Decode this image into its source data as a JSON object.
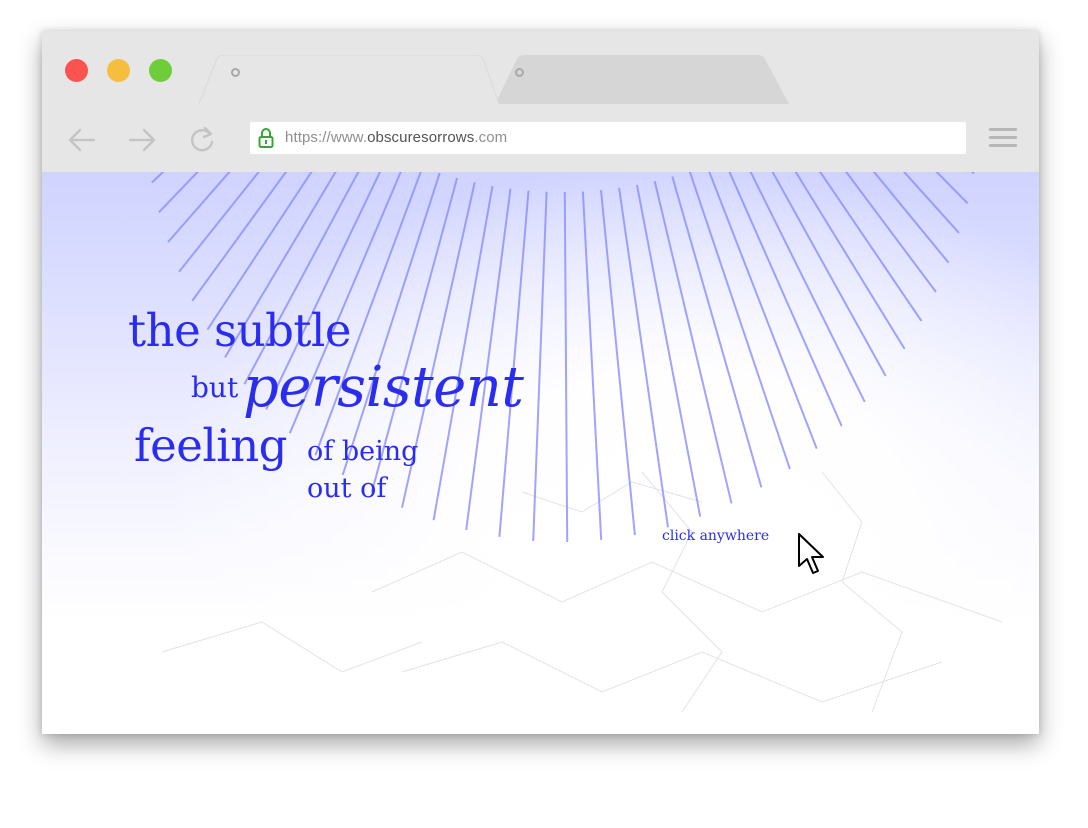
{
  "browser": {
    "url_prefix": "https://www.",
    "url_domain": "obscuresorrows",
    "url_suffix": ".com",
    "tabs": [
      {
        "label": ""
      },
      {
        "label": ""
      }
    ]
  },
  "page": {
    "lines": {
      "line1": "the subtle",
      "line2a": "but",
      "line2b": "persistent",
      "line3a": "feeling",
      "line3b": "of being",
      "line4": "out of"
    },
    "hint": "click anywhere",
    "accent_color": "#2a2df0",
    "ray_color": "#8a8cff"
  }
}
